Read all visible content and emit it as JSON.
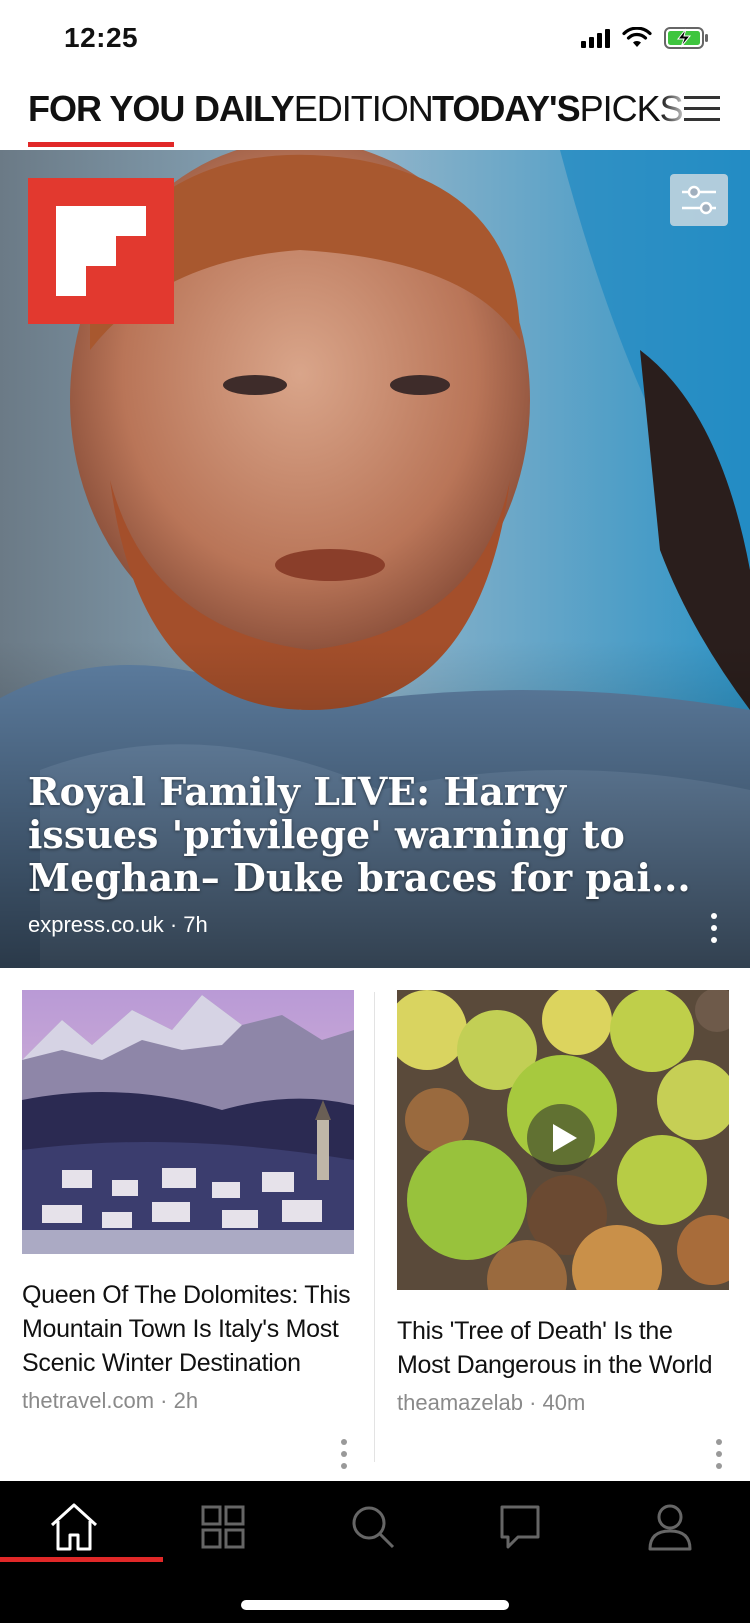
{
  "status_bar": {
    "time": "12:25",
    "icons": [
      "signal-icon",
      "wifi-icon",
      "battery-charging-icon"
    ]
  },
  "top_tabs": [
    {
      "bold": "FOR YOU",
      "thin": "",
      "active": true
    },
    {
      "bold": "DAILY",
      "thin": "EDITION",
      "active": false
    },
    {
      "bold": "TODAY'S",
      "thin": "PICKS",
      "active": false
    }
  ],
  "colors": {
    "accent": "#e12828",
    "logo": "#e2392f",
    "meta_gray": "#8a8a8a"
  },
  "hero": {
    "title": "Royal Family LIVE: Harry issues 'privilege' warning to Meghan– Duke braces for pai...",
    "meta": "express.co.uk · 7h"
  },
  "cards": [
    {
      "title": "Queen Of The Dolomites: This Mountain Town Is Italy's Most Scenic Winter Destination",
      "meta": "thetravel.com · 2h",
      "has_video": false
    },
    {
      "title": "This 'Tree of Death' Is the Most Dangerous in the World",
      "meta": "theamazelab · 40m",
      "has_video": true
    }
  ],
  "bottom_nav": [
    {
      "icon": "home-icon",
      "active": true
    },
    {
      "icon": "grid-icon",
      "active": false
    },
    {
      "icon": "search-icon",
      "active": false
    },
    {
      "icon": "chat-icon",
      "active": false
    },
    {
      "icon": "profile-icon",
      "active": false
    }
  ]
}
